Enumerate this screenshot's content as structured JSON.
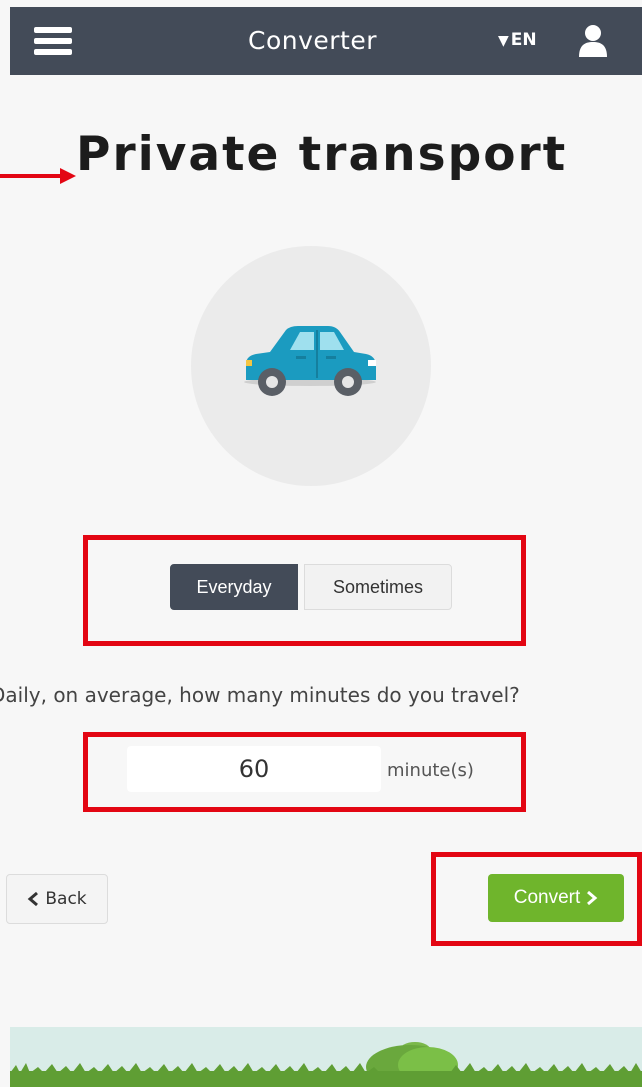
{
  "header": {
    "title": "Converter",
    "language": "EN",
    "menu_icon": "hamburger-menu-icon",
    "language_icon": "caret-down-icon",
    "user_icon": "user-icon"
  },
  "page": {
    "title": "Private transport",
    "illustration_icon": "car-icon"
  },
  "frequency": {
    "options": [
      "Everyday",
      "Sometimes"
    ],
    "selected": "Everyday"
  },
  "question": {
    "text": "Daily, on average, how many minutes do you travel?",
    "value": "60",
    "unit": "minute(s)"
  },
  "actions": {
    "back_label": "Back",
    "back_icon": "chevron-left-icon",
    "convert_label": "Convert",
    "convert_icon": "chevron-right-icon"
  },
  "colors": {
    "header_bg": "#434b58",
    "selected_toggle": "#434b58",
    "convert_button": "#6fb52c",
    "car": "#1b9bc0",
    "annotation": "#e30613"
  }
}
